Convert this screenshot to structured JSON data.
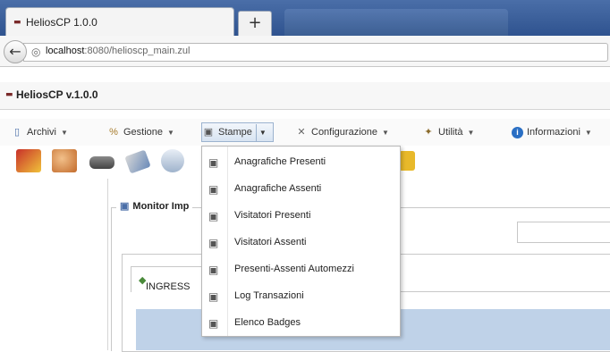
{
  "browser": {
    "tab_title": "HeliosCP 1.0.0",
    "new_tab_symbol": "+",
    "url_host": "localhost",
    "url_rest": ":8080/helioscp_main.zul"
  },
  "app": {
    "title": "HeliosCP v.1.0.0"
  },
  "menu": {
    "items": [
      {
        "label": "Archivi",
        "icon": "archive-icon"
      },
      {
        "label": "Gestione",
        "icon": "people-icon"
      },
      {
        "label": "Stampe",
        "icon": "printer-icon"
      },
      {
        "label": "Configurazione",
        "icon": "tools-icon"
      },
      {
        "label": "Utilità",
        "icon": "wand-icon"
      },
      {
        "label": "Informazioni",
        "icon": "info-icon"
      }
    ]
  },
  "toolbar": {
    "icons": [
      "id-card-icon",
      "users-icon",
      "car-icon",
      "badge-icon",
      "clock-icon",
      "report-icon"
    ]
  },
  "panel": {
    "title": "Monitor Imp",
    "inner_tab": "INGRESS"
  },
  "stampe_dropdown": {
    "items": [
      "Anagrafiche Presenti",
      "Anagrafiche Assenti",
      "Visitatori Presenti",
      "Visitatori Assenti",
      "Presenti-Assenti Automezzi",
      "Log Transazioni",
      "Elenco Badges"
    ]
  }
}
